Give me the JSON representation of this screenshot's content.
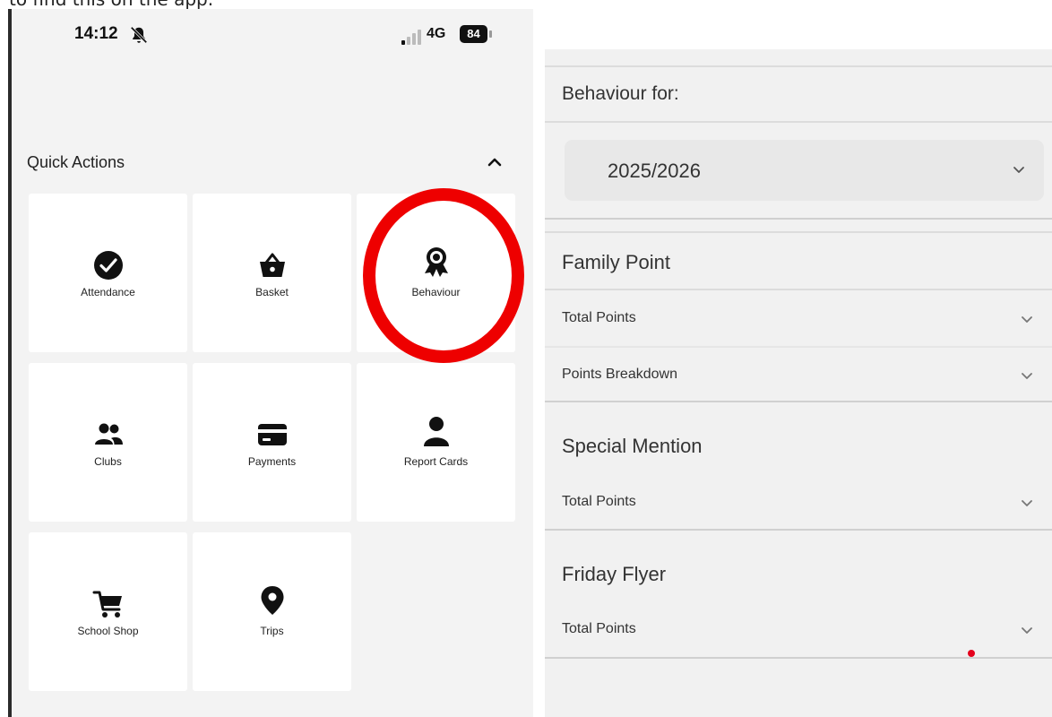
{
  "caption": "to find this on the app.",
  "phone": {
    "status": {
      "time": "14:12",
      "network": "4G",
      "battery": "84"
    },
    "quick_actions": {
      "title": "Quick Actions",
      "tiles": [
        {
          "label": "Attendance",
          "icon": "check-circle-icon"
        },
        {
          "label": "Basket",
          "icon": "basket-icon"
        },
        {
          "label": "Behaviour",
          "icon": "award-ribbon-icon"
        },
        {
          "label": "Clubs",
          "icon": "people-icon"
        },
        {
          "label": "Payments",
          "icon": "credit-card-icon"
        },
        {
          "label": "Report Cards",
          "icon": "person-icon"
        },
        {
          "label": "School Shop",
          "icon": "shopping-cart-icon"
        },
        {
          "label": "Trips",
          "icon": "location-pin-icon"
        }
      ]
    },
    "highlight_color": "#ee0000"
  },
  "behaviour": {
    "label": "Behaviour for:",
    "year": "2025/2026",
    "sections": [
      {
        "title": "Family Point",
        "rows": [
          "Total Points",
          "Points Breakdown"
        ]
      },
      {
        "title": "Special Mention",
        "rows": [
          "Total Points"
        ]
      },
      {
        "title": "Friday Flyer",
        "rows": [
          "Total Points"
        ]
      }
    ]
  }
}
